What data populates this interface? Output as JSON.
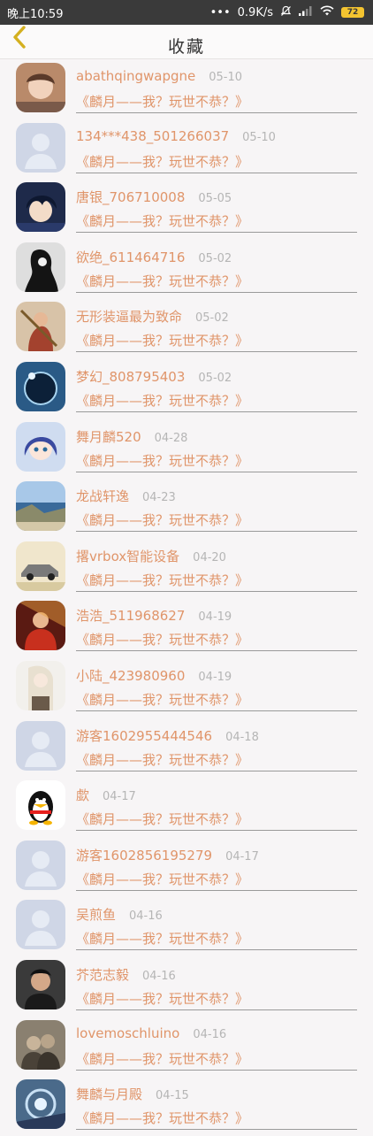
{
  "status_bar": {
    "time": "晚上10:59",
    "speed": "0.9K/s",
    "battery": "72"
  },
  "header": {
    "title": "收藏",
    "back_icon": "chevron-left-icon"
  },
  "colors": {
    "accent": "#e0956a",
    "date": "#b5b5b5",
    "back": "#d4b020"
  },
  "items": [
    {
      "name": "abathqingwapgne",
      "date": "05-10",
      "work": "《麟月——我？玩世不恭？》",
      "avatar": "photo-girl"
    },
    {
      "name": "134***438_501266037",
      "date": "05-10",
      "work": "《麟月——我？玩世不恭？》",
      "avatar": "default-user"
    },
    {
      "name": "唐银_706710008",
      "date": "05-05",
      "work": "《麟月——我？玩世不恭？》",
      "avatar": "anime-boy"
    },
    {
      "name": "欲绝_611464716",
      "date": "05-02",
      "work": "《麟月——我？玩世不恭？》",
      "avatar": "dark-figure"
    },
    {
      "name": "无形装逼最为致命",
      "date": "05-02",
      "work": "《麟月——我？玩世不恭？》",
      "avatar": "warrior"
    },
    {
      "name": "梦幻_808795403",
      "date": "05-02",
      "work": "《麟月——我？玩世不恭？》",
      "avatar": "planet"
    },
    {
      "name": "舞月麟520",
      "date": "04-28",
      "work": "《麟月——我？玩世不恭？》",
      "avatar": "anime-girl"
    },
    {
      "name": "龙战轩逸",
      "date": "04-23",
      "work": "《麟月——我？玩世不恭？》",
      "avatar": "seascape"
    },
    {
      "name": "撂vrbox智能设备",
      "date": "04-20",
      "work": "《麟月——我？玩世不恭？》",
      "avatar": "car"
    },
    {
      "name": "浩浩_511968627",
      "date": "04-19",
      "work": "《麟月——我？玩世不恭？》",
      "avatar": "hero-red"
    },
    {
      "name": "小陆_423980960",
      "date": "04-19",
      "work": "《麟月——我？玩世不恭？》",
      "avatar": "white-hair"
    },
    {
      "name": "游客1602955444546",
      "date": "04-18",
      "work": "《麟月——我？玩世不恭？》",
      "avatar": "default-user"
    },
    {
      "name": "歔",
      "date": "04-17",
      "work": "《麟月——我？玩世不恭？》",
      "avatar": "penguin"
    },
    {
      "name": "游客1602856195279",
      "date": "04-17",
      "work": "《麟月——我？玩世不恭？》",
      "avatar": "default-user"
    },
    {
      "name": "吴煎鱼",
      "date": "04-16",
      "work": "《麟月——我？玩世不恭？》",
      "avatar": "default-user"
    },
    {
      "name": "芥范志毅",
      "date": "04-16",
      "work": "《麟月——我？玩世不恭？》",
      "avatar": "man-photo"
    },
    {
      "name": "lovemoschluino",
      "date": "04-16",
      "work": "《麟月——我？玩世不恭？》",
      "avatar": "couple-photo"
    },
    {
      "name": "舞麟与月殿",
      "date": "04-15",
      "work": "《麟月——我？玩世不恭？》",
      "avatar": "blue-art"
    }
  ]
}
